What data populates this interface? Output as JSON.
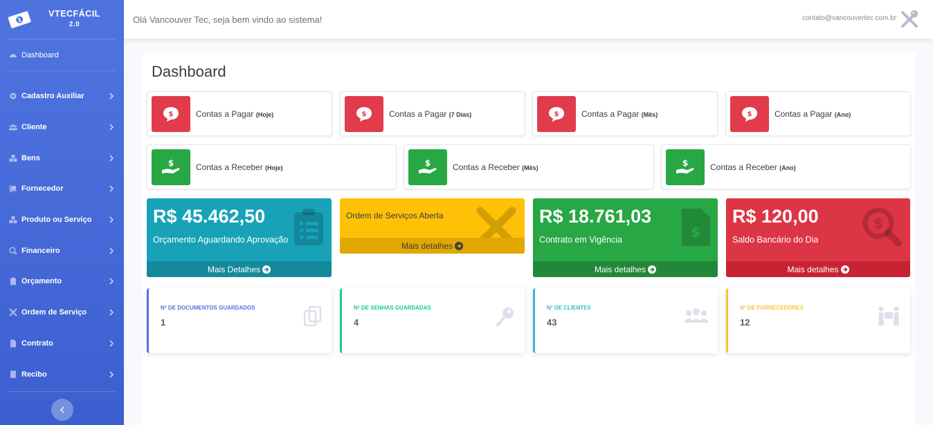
{
  "brand": {
    "name": "VTECFÁCIL",
    "version": "2.0"
  },
  "topbar": {
    "welcome": "Olá Vancouver Tec, seja bem vindo ao sistema!",
    "email": "contato@vancouvertec.com.br"
  },
  "sidebar": {
    "dashboard": "Dashboard",
    "items": [
      {
        "label": "Cadastro Auxiliar",
        "icon": "gear-icon"
      },
      {
        "label": "Cliente",
        "icon": "users-icon"
      },
      {
        "label": "Bens",
        "icon": "boxes-icon"
      },
      {
        "label": "Fornecedor",
        "icon": "dolly-icon"
      },
      {
        "label": "Produto ou Serviço",
        "icon": "cubes-icon"
      },
      {
        "label": "Financeiro",
        "icon": "search-dollar-icon"
      },
      {
        "label": "Orçamento",
        "icon": "clipboard-icon"
      },
      {
        "label": "Ordem de Serviço",
        "icon": "tools-icon"
      },
      {
        "label": "Contrato",
        "icon": "file-icon"
      },
      {
        "label": "Recibo",
        "icon": "receipt-icon"
      }
    ]
  },
  "page": {
    "title": "Dashboard"
  },
  "pagar": [
    {
      "label": "Contas a Pagar",
      "period": "(Hoje)"
    },
    {
      "label": "Contas a Pagar",
      "period": "(7 Dias)"
    },
    {
      "label": "Contas a Pagar",
      "period": "(Mês)"
    },
    {
      "label": "Contas a Pagar",
      "period": "(Ano)"
    }
  ],
  "receber": [
    {
      "label": "Contas a Receber",
      "period": "(Hoje)"
    },
    {
      "label": "Contas a Receber",
      "period": "(Mês)"
    },
    {
      "label": "Contas a Receber",
      "period": "(Ano)"
    }
  ],
  "summary": [
    {
      "value": "R$ 45.462,50",
      "desc": "Orçamento Aguardando Aprovação",
      "link": "Mais Detalhes",
      "color": "#17a2b8"
    },
    {
      "value": "",
      "desc": "Ordem de Serviços Aberta",
      "link": "Mais detalhes",
      "color": "#ffc107"
    },
    {
      "value": "R$ 18.761,03",
      "desc": "Contrato em Vigência",
      "link": "Mais detalhes",
      "color": "#28a745"
    },
    {
      "value": "R$ 120,00",
      "desc": "Saldo Bancário do Dia",
      "link": "Mais detalhes",
      "color": "#dc3545"
    }
  ],
  "stats": [
    {
      "label": "Nº de Documentos Guardados",
      "value": "1",
      "color": "#4e73df"
    },
    {
      "label": "Nº de Senhas Guardadas",
      "value": "4",
      "color": "#1cc88a"
    },
    {
      "label": "Nº de Clientes",
      "value": "43",
      "color": "#36b9cc"
    },
    {
      "label": "Nº de Fornecedores",
      "value": "12",
      "color": "#f6c23e"
    }
  ]
}
